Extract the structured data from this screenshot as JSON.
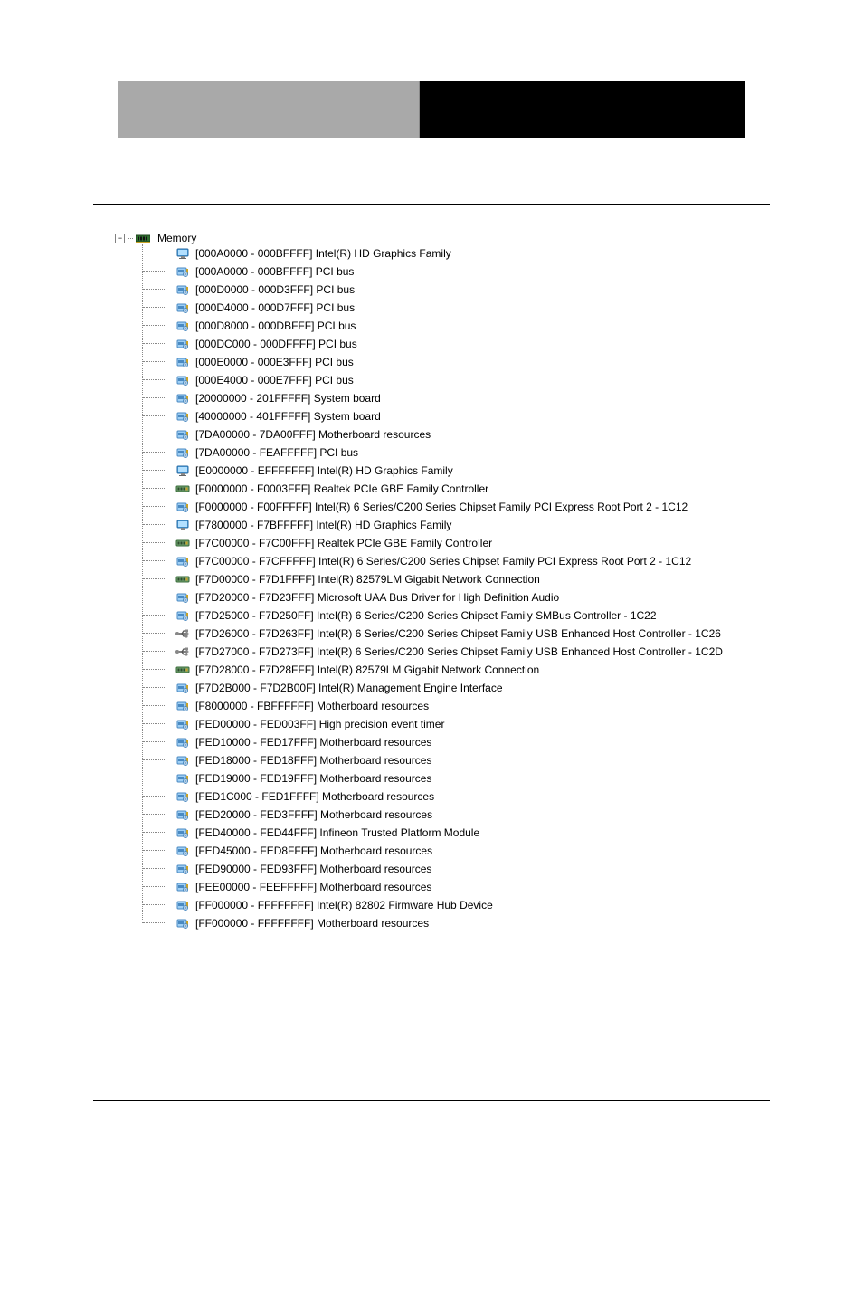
{
  "header": {
    "left_label": "",
    "right_label": ""
  },
  "tree": {
    "root_label": "Memory",
    "items": [
      {
        "icon": "display",
        "label": "[000A0000 - 000BFFFF]  Intel(R) HD Graphics Family"
      },
      {
        "icon": "card",
        "label": "[000A0000 - 000BFFFF]  PCI bus"
      },
      {
        "icon": "card",
        "label": "[000D0000 - 000D3FFF]  PCI bus"
      },
      {
        "icon": "card",
        "label": "[000D4000 - 000D7FFF]  PCI bus"
      },
      {
        "icon": "card",
        "label": "[000D8000 - 000DBFFF]  PCI bus"
      },
      {
        "icon": "card",
        "label": "[000DC000 - 000DFFFF]  PCI bus"
      },
      {
        "icon": "card",
        "label": "[000E0000 - 000E3FFF]  PCI bus"
      },
      {
        "icon": "card",
        "label": "[000E4000 - 000E7FFF]  PCI bus"
      },
      {
        "icon": "card",
        "label": "[20000000 - 201FFFFF]  System board"
      },
      {
        "icon": "card",
        "label": "[40000000 - 401FFFFF]  System board"
      },
      {
        "icon": "card",
        "label": "[7DA00000 - 7DA00FFF]  Motherboard resources"
      },
      {
        "icon": "card",
        "label": "[7DA00000 - FEAFFFFF]  PCI bus"
      },
      {
        "icon": "display",
        "label": "[E0000000 - EFFFFFFF]  Intel(R) HD Graphics Family"
      },
      {
        "icon": "network",
        "label": "[F0000000 - F0003FFF]  Realtek PCIe GBE Family Controller"
      },
      {
        "icon": "card",
        "label": "[F0000000 - F00FFFFF]  Intel(R) 6 Series/C200 Series Chipset Family PCI Express Root Port 2 - 1C12"
      },
      {
        "icon": "display",
        "label": "[F7800000 - F7BFFFFF]  Intel(R) HD Graphics Family"
      },
      {
        "icon": "network",
        "label": "[F7C00000 - F7C00FFF]  Realtek PCIe GBE Family Controller"
      },
      {
        "icon": "card",
        "label": "[F7C00000 - F7CFFFFF]  Intel(R) 6 Series/C200 Series Chipset Family PCI Express Root Port 2 - 1C12"
      },
      {
        "icon": "network",
        "label": "[F7D00000 - F7D1FFFF]  Intel(R) 82579LM Gigabit Network Connection"
      },
      {
        "icon": "card",
        "label": "[F7D20000 - F7D23FFF]  Microsoft UAA Bus Driver for High Definition Audio"
      },
      {
        "icon": "card",
        "label": "[F7D25000 - F7D250FF]  Intel(R) 6 Series/C200 Series Chipset Family SMBus Controller - 1C22"
      },
      {
        "icon": "usb",
        "label": "[F7D26000 - F7D263FF]  Intel(R) 6 Series/C200 Series Chipset Family USB Enhanced Host Controller - 1C26"
      },
      {
        "icon": "usb",
        "label": "[F7D27000 - F7D273FF]  Intel(R) 6 Series/C200 Series Chipset Family USB Enhanced Host Controller - 1C2D"
      },
      {
        "icon": "network",
        "label": "[F7D28000 - F7D28FFF]  Intel(R) 82579LM Gigabit Network Connection"
      },
      {
        "icon": "card",
        "label": "[F7D2B000 - F7D2B00F]  Intel(R) Management Engine Interface"
      },
      {
        "icon": "card",
        "label": "[F8000000 - FBFFFFFF]  Motherboard resources"
      },
      {
        "icon": "card",
        "label": "[FED00000 - FED003FF]  High precision event timer"
      },
      {
        "icon": "card",
        "label": "[FED10000 - FED17FFF]  Motherboard resources"
      },
      {
        "icon": "card",
        "label": "[FED18000 - FED18FFF]  Motherboard resources"
      },
      {
        "icon": "card",
        "label": "[FED19000 - FED19FFF]  Motherboard resources"
      },
      {
        "icon": "card",
        "label": "[FED1C000 - FED1FFFF]  Motherboard resources"
      },
      {
        "icon": "card",
        "label": "[FED20000 - FED3FFFF]  Motherboard resources"
      },
      {
        "icon": "card",
        "label": "[FED40000 - FED44FFF]  Infineon Trusted Platform Module"
      },
      {
        "icon": "card",
        "label": "[FED45000 - FED8FFFF]  Motherboard resources"
      },
      {
        "icon": "card",
        "label": "[FED90000 - FED93FFF]  Motherboard resources"
      },
      {
        "icon": "card",
        "label": "[FEE00000 - FEEFFFFF]  Motherboard resources"
      },
      {
        "icon": "card",
        "label": "[FF000000 - FFFFFFFF]  Intel(R) 82802 Firmware Hub Device"
      },
      {
        "icon": "card",
        "label": "[FF000000 - FFFFFFFF]  Motherboard resources"
      }
    ]
  }
}
